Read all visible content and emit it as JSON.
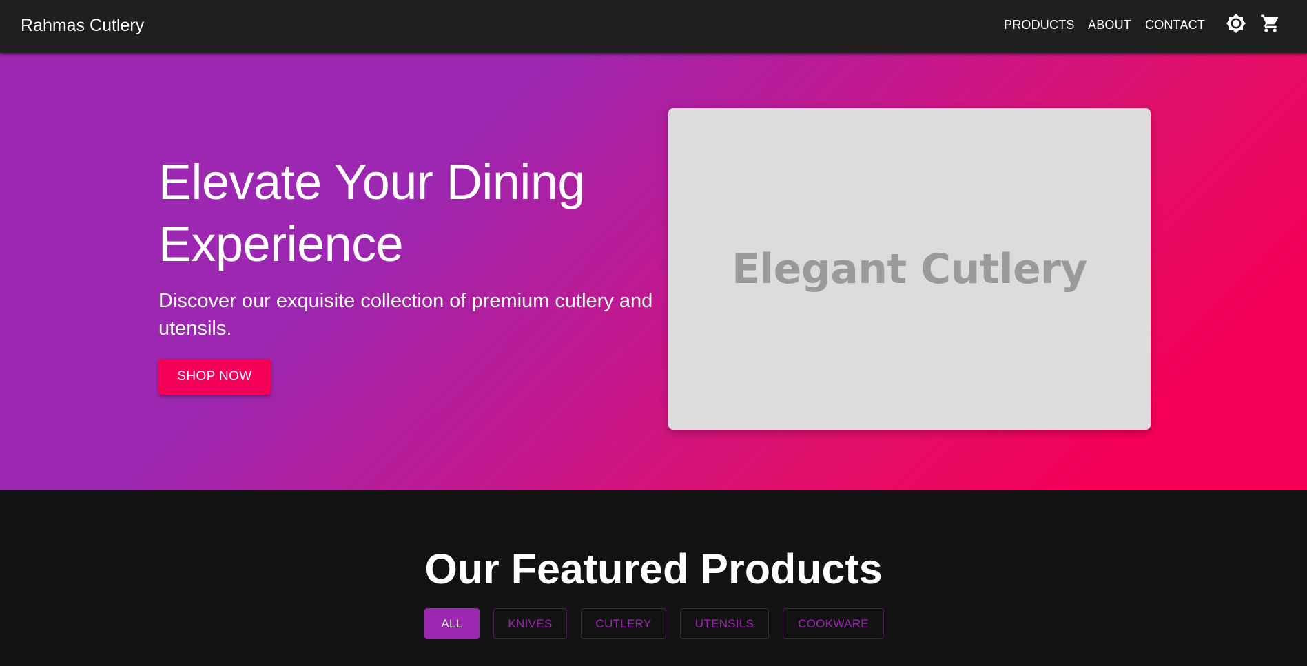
{
  "header": {
    "brand": "Rahmas Cutlery",
    "nav": [
      "PRODUCTS",
      "ABOUT",
      "CONTACT"
    ],
    "icons": [
      "brightness-icon",
      "shopping-cart-icon"
    ]
  },
  "hero": {
    "title": "Elevate Your Dining Experience",
    "subtitle": "Discover our exquisite collection of premium cutlery and utensils.",
    "cta": "SHOP NOW",
    "image_text": "Elegant Cutlery",
    "gradient": [
      "#9c27b0",
      "#f50057"
    ]
  },
  "featured": {
    "title": "Our Featured Products",
    "filters": [
      "ALL",
      "KNIVES",
      "CUTLERY",
      "UTENSILS",
      "COOKWARE"
    ],
    "active_filter": "ALL"
  },
  "colors": {
    "primary": "#9c27b0",
    "secondary": "#f50057",
    "appbar": "#1f1f1f",
    "background": "#121212"
  }
}
